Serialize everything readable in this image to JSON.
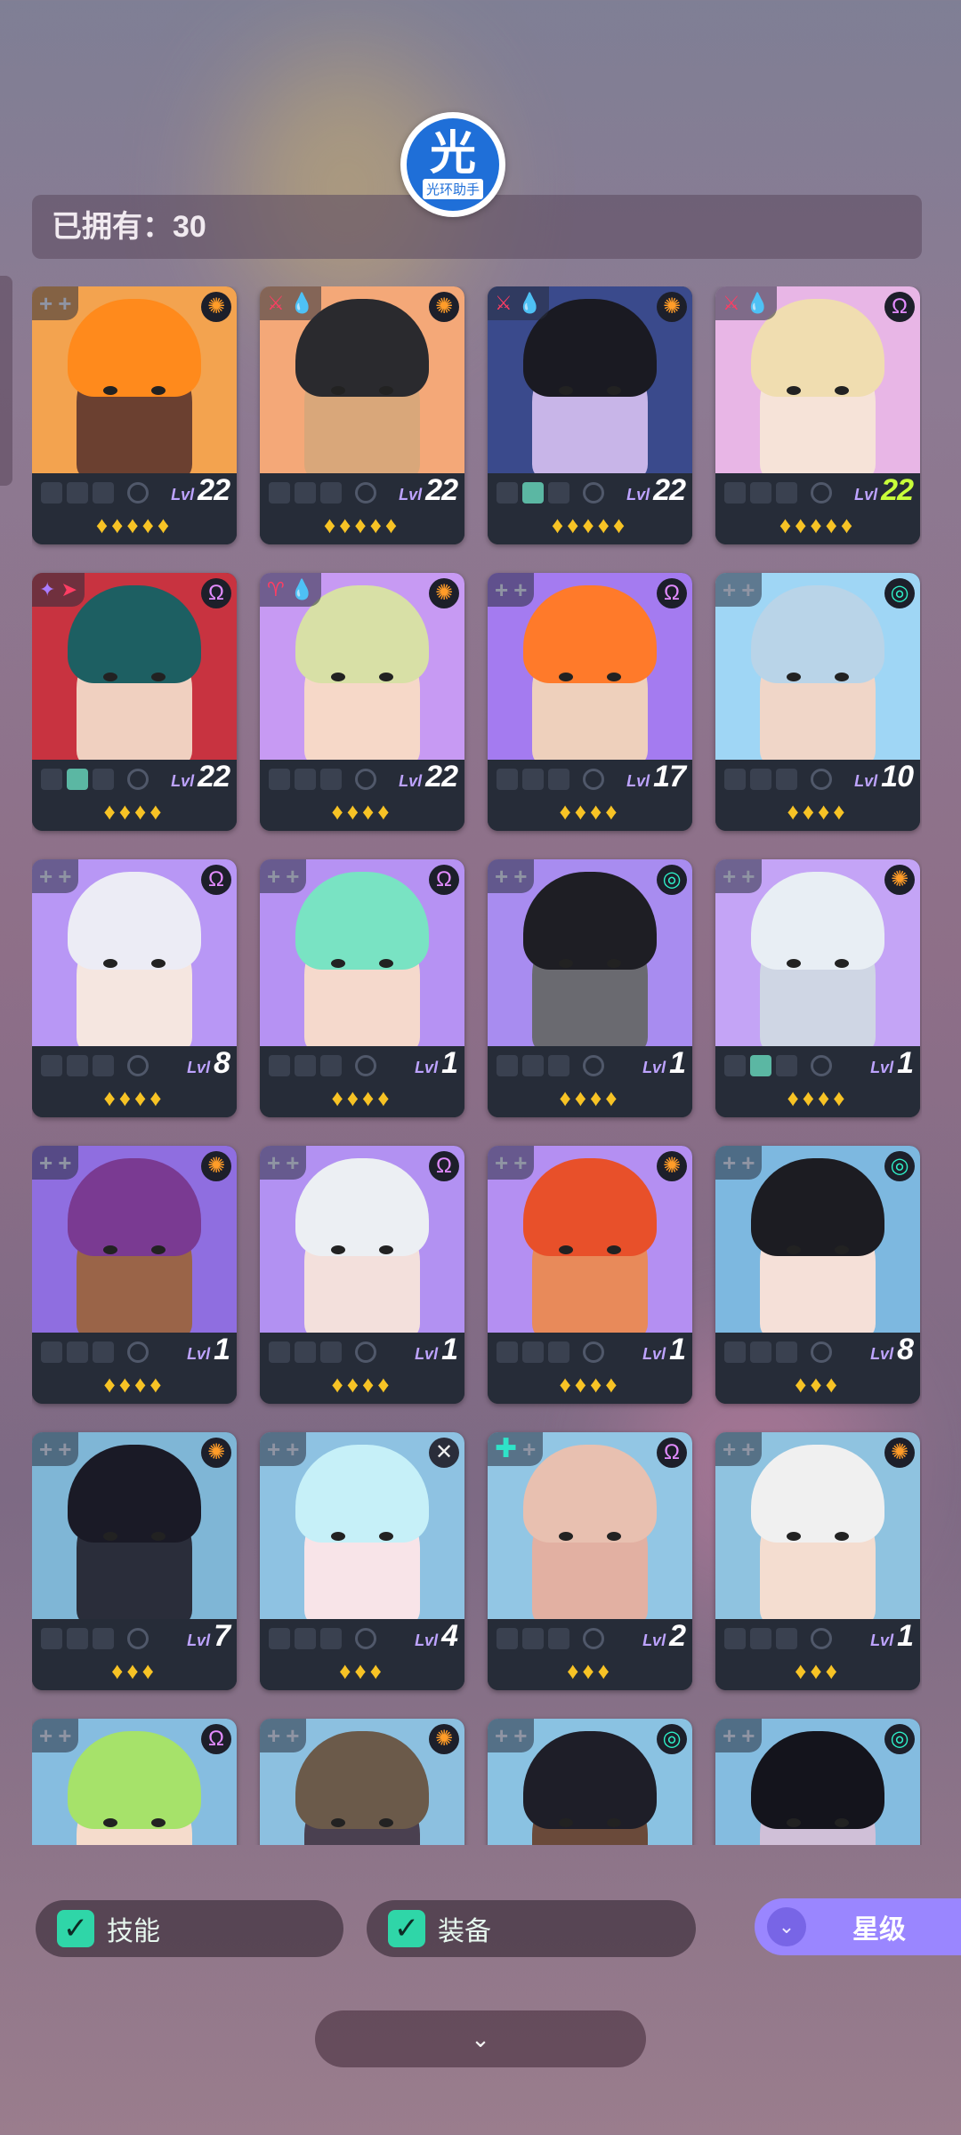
{
  "logo": {
    "glyph": "光",
    "text": "光环助手"
  },
  "owned": {
    "text": "已拥有：30"
  },
  "cards": [
    {
      "level": "22",
      "stars": "♦♦♦♦♦",
      "cls": "orange",
      "clsIcon": "✺",
      "bg": "#f3a34f",
      "hair": "#ff8a1c",
      "skin": "#6b4030",
      "slots": [
        0,
        0,
        0
      ],
      "icons": [
        "+",
        "+"
      ],
      "iconColors": [
        "plus",
        "plus"
      ]
    },
    {
      "level": "22",
      "stars": "♦♦♦♦♦",
      "cls": "orange",
      "clsIcon": "✺",
      "bg": "#f4a878",
      "hair": "#2a2a2e",
      "skin": "#d9a77a",
      "slots": [
        0,
        0,
        0
      ],
      "icons": [
        "⚔",
        "💧"
      ],
      "iconColors": [
        "red",
        "blue"
      ]
    },
    {
      "level": "22",
      "stars": "♦♦♦♦♦",
      "cls": "orange",
      "clsIcon": "✺",
      "bg": "#3a4a8c",
      "hair": "#1a1a22",
      "skin": "#c8b5e8",
      "slots": [
        0,
        1,
        0
      ],
      "icons": [
        "⚔",
        "💧"
      ],
      "iconColors": [
        "red",
        "blue"
      ]
    },
    {
      "level": "22",
      "stars": "♦♦♦♦♦",
      "cls": "purple",
      "clsIcon": "Ω",
      "bg": "#e8b6e6",
      "hair": "#f0ddb0",
      "skin": "#f6e3d8",
      "slots": [
        0,
        0,
        0
      ],
      "icons": [
        "⚔",
        "💧"
      ],
      "iconColors": [
        "red",
        "blue"
      ],
      "hi": true
    },
    {
      "level": "22",
      "stars": "♦♦♦♦",
      "cls": "purple",
      "clsIcon": "Ω",
      "bg": "#c83340",
      "hair": "#1d5f62",
      "skin": "#f0d0c0",
      "slots": [
        0,
        1,
        0
      ],
      "icons": [
        "✦",
        "➤"
      ],
      "iconColors": [
        "purple",
        "red"
      ]
    },
    {
      "level": "22",
      "stars": "♦♦♦♦",
      "cls": "orange",
      "clsIcon": "✺",
      "bg": "#c79af3",
      "hair": "#d8e0a6",
      "skin": "#f6d8c8",
      "slots": [
        0,
        0,
        0
      ],
      "icons": [
        "♈",
        "💧"
      ],
      "iconColors": [
        "red",
        "blue"
      ]
    },
    {
      "level": "17",
      "stars": "♦♦♦♦",
      "cls": "purple",
      "clsIcon": "Ω",
      "bg": "#a47bf0",
      "hair": "#ff7a2a",
      "skin": "#eed0bc",
      "slots": [
        0,
        0,
        0
      ],
      "icons": [
        "+",
        "+"
      ],
      "iconColors": [
        "plus",
        "plus"
      ]
    },
    {
      "level": "10",
      "stars": "♦♦♦♦",
      "cls": "teal",
      "clsIcon": "◎",
      "bg": "#9fd6f5",
      "hair": "#b9d4e8",
      "skin": "#f0d6c8",
      "slots": [
        0,
        0,
        0
      ],
      "icons": [
        "+",
        "+"
      ],
      "iconColors": [
        "plus",
        "plus"
      ]
    },
    {
      "level": "8",
      "stars": "♦♦♦♦",
      "cls": "purple",
      "clsIcon": "Ω",
      "bg": "#b897f5",
      "hair": "#ececf5",
      "skin": "#f5e6e0",
      "slots": [
        0,
        0,
        0
      ],
      "icons": [
        "+",
        "+"
      ],
      "iconColors": [
        "plus",
        "plus"
      ]
    },
    {
      "level": "1",
      "stars": "♦♦♦♦",
      "cls": "purple",
      "clsIcon": "Ω",
      "bg": "#b692f3",
      "hair": "#79e3c3",
      "skin": "#f5d9cc",
      "slots": [
        0,
        0,
        0
      ],
      "icons": [
        "+",
        "+"
      ],
      "iconColors": [
        "plus",
        "plus"
      ]
    },
    {
      "level": "1",
      "stars": "♦♦♦♦",
      "cls": "teal",
      "clsIcon": "◎",
      "bg": "#a88cf0",
      "hair": "#1e1e24",
      "skin": "#6a6a70",
      "slots": [
        0,
        0,
        0
      ],
      "icons": [
        "+",
        "+"
      ],
      "iconColors": [
        "plus",
        "plus"
      ]
    },
    {
      "level": "1",
      "stars": "♦♦♦♦",
      "cls": "orange",
      "clsIcon": "✺",
      "bg": "#c4a4f6",
      "hair": "#e8eef4",
      "skin": "#cfd6e4",
      "slots": [
        0,
        1,
        0
      ],
      "icons": [
        "+",
        "+"
      ],
      "iconColors": [
        "plus",
        "plus"
      ]
    },
    {
      "level": "1",
      "stars": "♦♦♦♦",
      "cls": "orange",
      "clsIcon": "✺",
      "bg": "#8f6ee0",
      "hair": "#7a3a92",
      "skin": "#9a6448",
      "slots": [
        0,
        0,
        0
      ],
      "icons": [
        "+",
        "+"
      ],
      "iconColors": [
        "plus",
        "plus"
      ]
    },
    {
      "level": "1",
      "stars": "♦♦♦♦",
      "cls": "purple",
      "clsIcon": "Ω",
      "bg": "#b291f2",
      "hair": "#eceff3",
      "skin": "#f3e0dc",
      "slots": [
        0,
        0,
        0
      ],
      "icons": [
        "+",
        "+"
      ],
      "iconColors": [
        "plus",
        "plus"
      ]
    },
    {
      "level": "1",
      "stars": "♦♦♦♦",
      "cls": "orange",
      "clsIcon": "✺",
      "bg": "#b48ff2",
      "hair": "#e8502a",
      "skin": "#e88a5a",
      "slots": [
        0,
        0,
        0
      ],
      "icons": [
        "+",
        "+"
      ],
      "iconColors": [
        "plus",
        "plus"
      ]
    },
    {
      "level": "8",
      "stars": "♦♦♦",
      "cls": "teal",
      "clsIcon": "◎",
      "bg": "#7db8e0",
      "hair": "#1c1c22",
      "skin": "#f5e0d8",
      "slots": [
        0,
        0,
        0
      ],
      "icons": [
        "+",
        "+"
      ],
      "iconColors": [
        "plus",
        "plus"
      ]
    },
    {
      "level": "7",
      "stars": "♦♦♦",
      "cls": "orange",
      "clsIcon": "✺",
      "bg": "#7fb6d6",
      "hair": "#1a1a26",
      "skin": "#2a2d3a",
      "slots": [
        0,
        0,
        0
      ],
      "icons": [
        "+",
        "+"
      ],
      "iconColors": [
        "plus",
        "plus"
      ]
    },
    {
      "level": "4",
      "stars": "♦♦♦",
      "cls": "white",
      "clsIcon": "✕",
      "bg": "#8ec2e2",
      "hair": "#c6f0f8",
      "skin": "#f8e4e8",
      "slots": [
        0,
        0,
        0
      ],
      "icons": [
        "+",
        "+"
      ],
      "iconColors": [
        "plus",
        "plus"
      ]
    },
    {
      "level": "2",
      "stars": "♦♦♦",
      "cls": "purple",
      "clsIcon": "Ω",
      "bg": "#92c6e4",
      "hair": "#e8c0b0",
      "skin": "#e2b0a2",
      "slots": [
        0,
        0,
        0
      ],
      "icons": [
        "✚",
        "+"
      ],
      "iconColors": [
        "teal",
        "plus"
      ]
    },
    {
      "level": "1",
      "stars": "♦♦♦",
      "cls": "orange",
      "clsIcon": "✺",
      "bg": "#8fc3e0",
      "hair": "#f0f0f0",
      "skin": "#f4ddd0",
      "slots": [
        0,
        0,
        0
      ],
      "icons": [
        "+",
        "+"
      ],
      "iconColors": [
        "plus",
        "plus"
      ]
    },
    {
      "level": "",
      "stars": "",
      "cls": "purple",
      "clsIcon": "Ω",
      "bg": "#86bde0",
      "hair": "#a6e26a",
      "skin": "#f5dccc",
      "slots": [
        0,
        0,
        0
      ],
      "icons": [
        "+",
        "+"
      ],
      "iconColors": [
        "plus",
        "plus"
      ]
    },
    {
      "level": "",
      "stars": "",
      "cls": "orange",
      "clsIcon": "✺",
      "bg": "#8cc0e0",
      "hair": "#6b5a4a",
      "skin": "#4a4050",
      "slots": [
        0,
        0,
        0
      ],
      "icons": [
        "+",
        "+"
      ],
      "iconColors": [
        "plus",
        "plus"
      ]
    },
    {
      "level": "",
      "stars": "",
      "cls": "teal",
      "clsIcon": "◎",
      "bg": "#8ac2e2",
      "hair": "#1e1e28",
      "skin": "#6a4a3a",
      "slots": [
        0,
        0,
        0
      ],
      "icons": [
        "+",
        "+"
      ],
      "iconColors": [
        "plus",
        "plus"
      ]
    },
    {
      "level": "",
      "stars": "",
      "cls": "teal",
      "clsIcon": "◎",
      "bg": "#84bce0",
      "hair": "#14141c",
      "skin": "#d0c0d8",
      "slots": [
        0,
        0,
        0
      ],
      "icons": [
        "+",
        "+"
      ],
      "iconColors": [
        "plus",
        "plus"
      ]
    }
  ],
  "level_prefix": "Lvl",
  "filters": {
    "skill": "技能",
    "equipment": "装备"
  },
  "sort": {
    "label": "星级"
  },
  "collapse": {
    "icon": "⌄"
  }
}
